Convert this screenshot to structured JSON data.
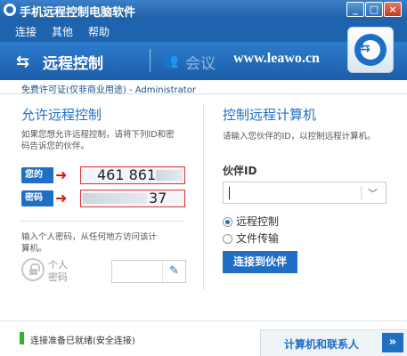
{
  "window": {
    "title": "手机远程控制电脑软件",
    "buttons": [
      "_",
      "□",
      "×"
    ]
  },
  "menu": {
    "items": [
      "连接",
      "其他",
      "帮助"
    ]
  },
  "header": {
    "remote_label": "远程控制",
    "meeting_label": "会议",
    "watermark": "www.leawo.cn",
    "swap_glyph": "⇆",
    "meeting_glyph": "👥"
  },
  "license": "免费许可证(仅非商业用途) - Administrator",
  "left": {
    "heading": "允许远程控制",
    "desc_line1": "如果您想允许远程控制，请将下列ID和密",
    "desc_line2": "码告诉您的伙伴。",
    "id_label": "您的ID",
    "id_value": "461 861",
    "pwd_label": "密码",
    "pwd_value": "37",
    "personal_line1": "输入个人密码，从任何地方访问该计",
    "personal_line2": "算机。",
    "personal_pwd_line1": "个人",
    "personal_pwd_line2": "密码",
    "edit_glyph": "✎"
  },
  "right": {
    "heading": "控制远程计算机",
    "desc": "请输入您伙伴的ID，以控制远程计算机。",
    "partner_label": "伙伴ID",
    "partner_value": "",
    "options": [
      "远程控制",
      "文件传输"
    ],
    "selected_option": "远程控制",
    "connect_label": "连接到伙伴",
    "chevron_glyph": "﹀"
  },
  "footer": {
    "status": "连接准备已就绪(安全连接)",
    "status_color": "#28b832",
    "contacts_label": "计算机和联系人",
    "contacts_glyph": "»"
  },
  "colors": {
    "accent": "#1f6fc4",
    "header": "#1b5ea8",
    "highlight": "#e03030"
  }
}
